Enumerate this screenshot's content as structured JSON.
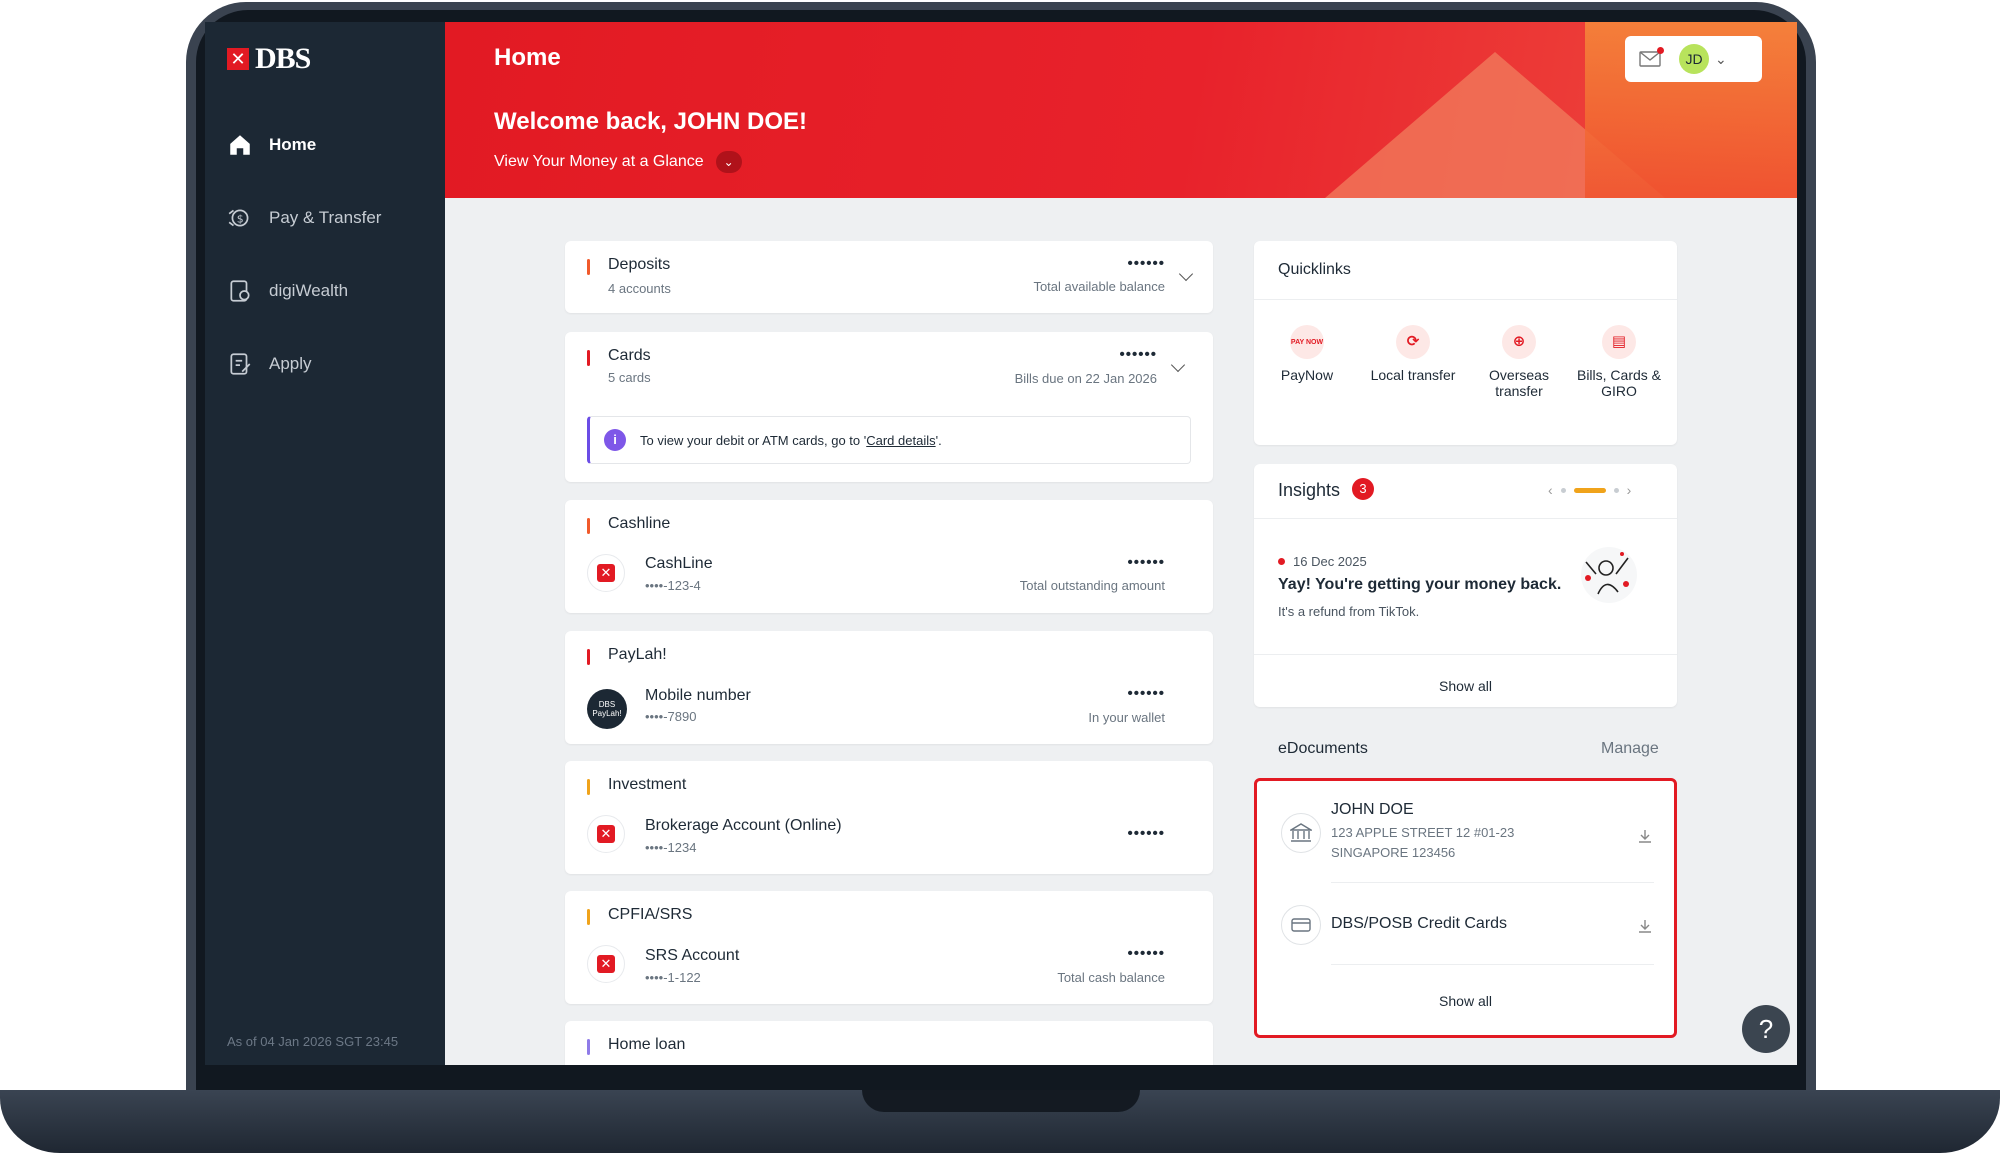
{
  "sidebar": {
    "logo_text": "DBS",
    "items": [
      {
        "label": "Home",
        "icon": "home-icon"
      },
      {
        "label": "Pay & Transfer",
        "icon": "transfer-icon"
      },
      {
        "label": "digiWealth",
        "icon": "wealth-icon"
      },
      {
        "label": "Apply",
        "icon": "apply-icon"
      }
    ],
    "footer": "As of 04 Jan 2026 SGT 23:45"
  },
  "header": {
    "title": "Home",
    "welcome": "Welcome back, JOHN DOE!",
    "glance": "View Your Money at a Glance",
    "avatar_initials": "JD"
  },
  "accounts": {
    "deposits": {
      "title": "Deposits",
      "sub": "4 accounts",
      "masked": "••••••",
      "label": "Total available balance"
    },
    "cards": {
      "title": "Cards",
      "sub": "5 cards",
      "masked": "••••••",
      "label": "Bills due on 22 Jan 2026",
      "info_text": "To view your debit or ATM cards, go to '",
      "info_link": "Card details",
      "info_end": "'."
    },
    "cashline": {
      "title": "Cashline",
      "name": "CashLine",
      "num": "••••-123-4",
      "masked": "••••••",
      "label": "Total outstanding amount"
    },
    "paylah": {
      "title": "PayLah!",
      "name": "Mobile number",
      "num": "••••-7890",
      "masked": "••••••",
      "label": "In your wallet",
      "icon_text": "DBS PayLah!"
    },
    "investment": {
      "title": "Investment",
      "name": "Brokerage Account (Online)",
      "num": "••••-1234",
      "masked": "••••••"
    },
    "cpfia": {
      "title": "CPFIA/SRS",
      "name": "SRS Account",
      "num": "••••-1-122",
      "masked": "••••••",
      "label": "Total cash balance"
    },
    "homeloan": {
      "title": "Home loan"
    }
  },
  "quicklinks": {
    "title": "Quicklinks",
    "items": [
      {
        "label": "PayNow",
        "icon_text": "PAY NOW"
      },
      {
        "label": "Local transfer",
        "icon_text": "⟳"
      },
      {
        "label": "Overseas transfer",
        "icon_text": "⊕"
      },
      {
        "label": "Bills, Cards & GIRO",
        "icon_text": "▤"
      }
    ]
  },
  "insights": {
    "title": "Insights",
    "count": "3",
    "date": "16 Dec 2025",
    "headline": "Yay! You're getting your money back.",
    "desc": "It's a refund from TikTok.",
    "show_all": "Show all"
  },
  "edocuments": {
    "title": "eDocuments",
    "manage": "Manage",
    "name": "JOHN DOE",
    "addr1": "123 APPLE STREET 12 #01-23",
    "addr2": "SINGAPORE 123456",
    "card_doc": "DBS/POSB Credit Cards",
    "show_all": "Show all"
  },
  "help": "?",
  "colors": {
    "brand_red": "#e21a23",
    "sidebar_bg": "#1c2834",
    "highlight_border": "#e21a23"
  }
}
